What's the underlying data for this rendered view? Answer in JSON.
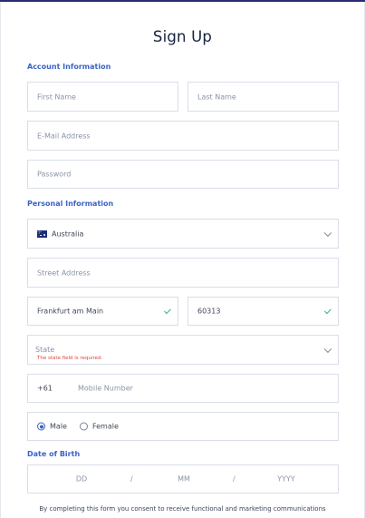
{
  "title": "Sign Up",
  "sections": {
    "account": "Account Information",
    "personal": "Personal Information",
    "dob": "Date of Birth"
  },
  "fields": {
    "first_name": {
      "placeholder": "First Name"
    },
    "last_name": {
      "placeholder": "Last Name"
    },
    "email": {
      "placeholder": "E-Mail Address"
    },
    "password": {
      "placeholder": "Password"
    },
    "country": {
      "value": "Australia",
      "icon": "australia-flag-icon"
    },
    "street": {
      "placeholder": "Street Address"
    },
    "city": {
      "value": "Frankfurt am Main"
    },
    "postcode": {
      "value": "60313"
    },
    "state": {
      "placeholder": "State",
      "error": "The state field is required."
    },
    "phone": {
      "prefix": "+61",
      "placeholder": "Mobile Number"
    },
    "gender": {
      "options": [
        "Male",
        "Female"
      ],
      "selected": "Male"
    },
    "dob": {
      "day": "DD",
      "month": "MM",
      "year": "YYYY",
      "separator": "/"
    }
  },
  "consent": "By completing this form you consent to receive functional and marketing communications",
  "colors": {
    "accent": "#3a63c6",
    "error": "#e04545",
    "valid": "#36b37e",
    "border": "#d9dee8",
    "title": "#15223f"
  }
}
